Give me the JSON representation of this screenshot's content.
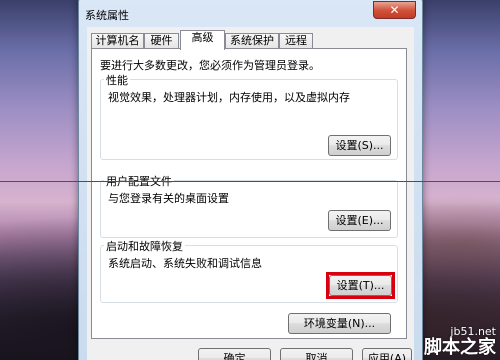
{
  "window": {
    "title": "系统属性",
    "close_glyph": "✕"
  },
  "tabs": [
    {
      "label": "计算机名",
      "active": false
    },
    {
      "label": "硬件",
      "active": false
    },
    {
      "label": "高级",
      "active": true
    },
    {
      "label": "系统保护",
      "active": false
    },
    {
      "label": "远程",
      "active": false
    }
  ],
  "advanced": {
    "intro": "要进行大多数更改，您必须作为管理员登录。",
    "performance": {
      "title": "性能",
      "desc": "视觉效果，处理器计划，内存使用，以及虚拟内存",
      "button": "设置(S)..."
    },
    "user_profiles": {
      "title": "用户配置文件",
      "desc": "与您登录有关的桌面设置",
      "button": "设置(E)..."
    },
    "startup_recovery": {
      "title": "启动和故障恢复",
      "desc": "系统启动、系统失败和调试信息",
      "button": "设置(T)..."
    },
    "env_vars_button": "环境变量(N)..."
  },
  "footer": {
    "ok": "确定",
    "cancel": "取消",
    "apply": "应用(A)"
  },
  "watermark": {
    "site": "jb51.net",
    "brand": "脚本之家"
  },
  "colors": {
    "highlight": "#d8000f",
    "annotation_line": "#b32626"
  }
}
